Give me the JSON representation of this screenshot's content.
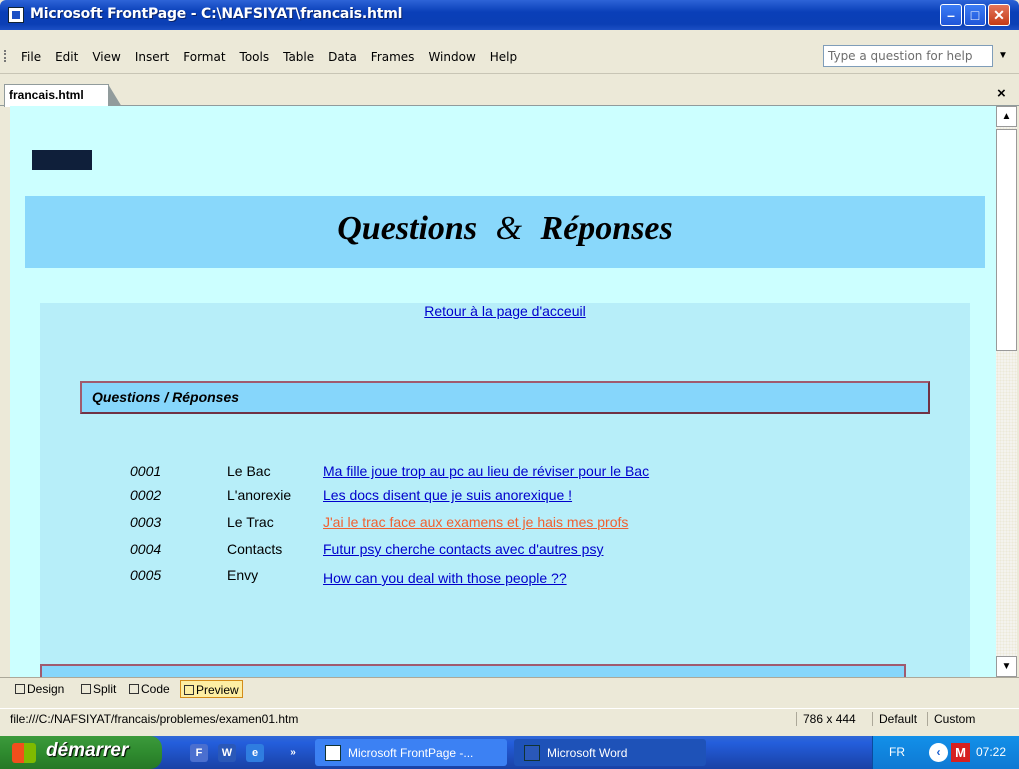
{
  "window": {
    "title": "Microsoft FrontPage - C:\\NAFSIYAT\\francais.html"
  },
  "menu": {
    "items": [
      "File",
      "Edit",
      "View",
      "Insert",
      "Format",
      "Tools",
      "Table",
      "Data",
      "Frames",
      "Window",
      "Help"
    ],
    "help_placeholder": "Type a question for help"
  },
  "tab": {
    "label": "francais.html",
    "close": "×"
  },
  "page": {
    "heading_questions": "Questions",
    "heading_amp": "&",
    "heading_reponses": "Réponses",
    "home_link": "Retour à la page d'acceuil",
    "qa_box_title": "Questions / Réponses",
    "rows": [
      {
        "num": "0001",
        "topic": "Le Bac",
        "link": "Ma fille joue trop au pc au lieu de réviser pour le Bac",
        "visited": false
      },
      {
        "num": "0002",
        "topic": "L'anorexie",
        "link": "Les docs disent que je suis anorexique !",
        "visited": false
      },
      {
        "num": "0003",
        "topic": "Le Trac",
        "link": "J'ai le trac face aux examens et je hais mes profs",
        "visited": true
      },
      {
        "num": "0004",
        "topic": "Contacts",
        "link": "Futur psy cherche contacts avec d'autres psy",
        "visited": false
      },
      {
        "num": "0005",
        "topic": "Envy",
        "link": "How can you deal with those people ??",
        "visited": false
      }
    ]
  },
  "view_tabs": {
    "design": "Design",
    "split": "Split",
    "code": "Code",
    "preview": "Preview"
  },
  "status": {
    "url": "file:///C:/NAFSIYAT/francais/problemes/examen01.htm",
    "size": "786 x 444",
    "mode": "Default",
    "custom": "Custom"
  },
  "taskbar": {
    "start": "démarrer",
    "frontpage_task": "Microsoft FrontPage -...",
    "word_task": "Microsoft Word",
    "lang": "FR",
    "clock": "07:22"
  },
  "colors": {
    "page_bg": "#ccffff",
    "band": "#89d8fb",
    "panel": "#b7eef9",
    "link": "#0000cc",
    "visited_link": "#f06030"
  }
}
